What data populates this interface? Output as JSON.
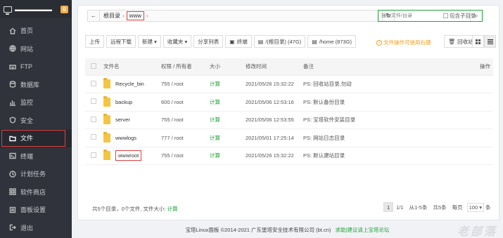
{
  "sidebar": {
    "hostname": "▬▬▬▬▬▬▬",
    "badge": "0",
    "items": [
      {
        "label": "首页",
        "icon": "home-icon"
      },
      {
        "label": "网站",
        "icon": "globe-icon"
      },
      {
        "label": "FTP",
        "icon": "ftp-icon"
      },
      {
        "label": "数据库",
        "icon": "database-icon"
      },
      {
        "label": "监控",
        "icon": "monitor-icon"
      },
      {
        "label": "安全",
        "icon": "shield-icon"
      },
      {
        "label": "文件",
        "icon": "folder-icon",
        "active": true
      },
      {
        "label": "终端",
        "icon": "terminal-icon"
      },
      {
        "label": "计划任务",
        "icon": "clock-icon"
      },
      {
        "label": "软件商店",
        "icon": "store-icon"
      },
      {
        "label": "面板设置",
        "icon": "settings-icon"
      },
      {
        "label": "退出",
        "icon": "logout-icon"
      }
    ]
  },
  "path": {
    "back": "←",
    "root": "根目录",
    "sep": "›",
    "current": "www",
    "refresh": "↻"
  },
  "search": {
    "placeholder": "搜索文件/目录",
    "include_sub": "包含子目录",
    "icon": "search-icon"
  },
  "toolbar": {
    "upload": "上传",
    "remote_download": "远程下载",
    "new": "新建",
    "favorites": "收藏夹",
    "share_list": "分享列表",
    "terminal": "终端",
    "disk_root": "/(根目录) (47G)",
    "disk_home": "/home (873G)",
    "tip": "文件操作可使用右键",
    "recycle": "回收站"
  },
  "table": {
    "headers": [
      "文件名",
      "权限 / 所有者",
      "大小",
      "修改时间",
      "备注",
      "操作"
    ],
    "rows": [
      {
        "name": "Recycle_bin",
        "perm": "755 / root",
        "size": "计算",
        "mtime": "2021/05/26 15:32:22",
        "note": "PS: 回收站目录,勿动"
      },
      {
        "name": "backup",
        "perm": "600 / root",
        "size": "计算",
        "mtime": "2021/05/06 12:53:16",
        "note": "PS: 默认备份目录"
      },
      {
        "name": "server",
        "perm": "755 / root",
        "size": "计算",
        "mtime": "2021/05/06 12:53:55",
        "note": "PS: 宝塔软件安装目录"
      },
      {
        "name": "wwwlogs",
        "perm": "777 / root",
        "size": "计算",
        "mtime": "2021/05/01 17:25:14",
        "note": "PS: 网站日志目录"
      },
      {
        "name": "wwwroot",
        "perm": "755 / root",
        "size": "计算",
        "mtime": "2021/05/26 15:32:22",
        "note": "PS: 默认建站目录"
      }
    ]
  },
  "footer": {
    "summary": "共5个目录，0个文件, 文件大小:",
    "calc": "计算"
  },
  "pager": {
    "page": "1",
    "of": "1/1",
    "range": "从1-5条",
    "total": "共5条",
    "per_page_label": "每页",
    "per_page": "100",
    "unit": "条"
  },
  "copyright": {
    "text": "宝塔Linux面板 ©2014-2021 广东堡塔安全技术有限公司 (bt.cn)",
    "link": "求助|建议请上宝塔论坛"
  },
  "watermark": "老部落"
}
